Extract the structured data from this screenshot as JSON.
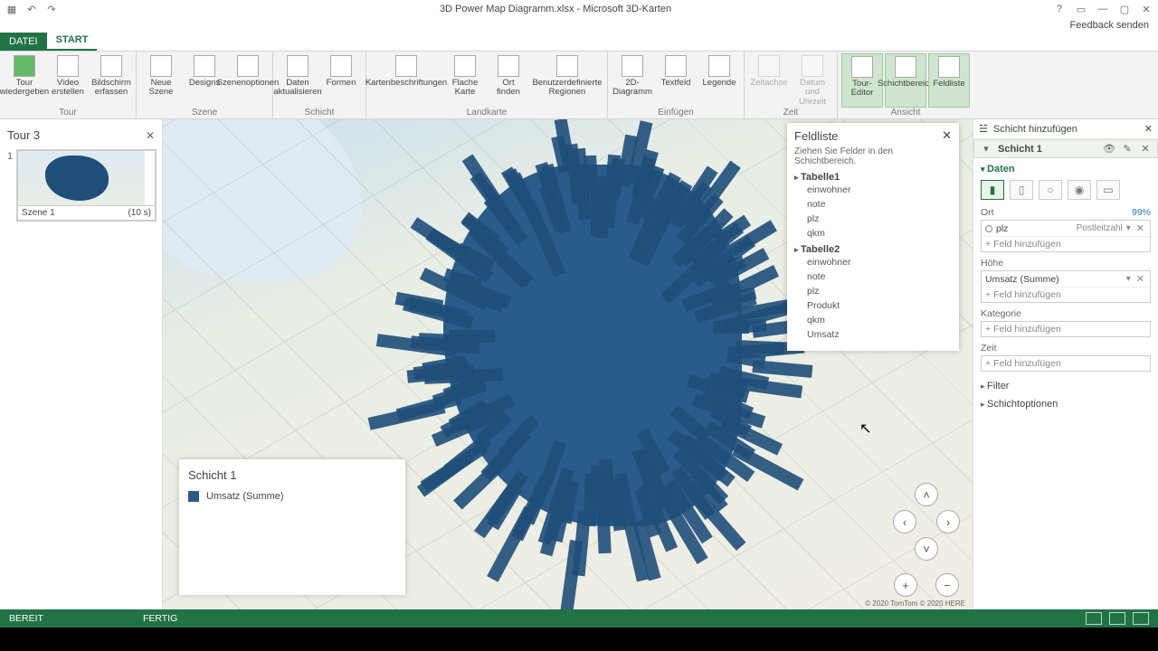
{
  "titlebar": {
    "title": "3D Power Map Diagramm.xlsx - Microsoft 3D-Karten"
  },
  "feedback": "Feedback senden",
  "tabs": {
    "file": "DATEI",
    "start": "START"
  },
  "ribbon": {
    "groups": {
      "tour": {
        "label": "Tour",
        "items": [
          "Tour\nwiedergeben",
          "Video\nerstellen",
          "Bildschirm\nerfassen"
        ]
      },
      "szene": {
        "label": "Szene",
        "items": [
          "Neue\nSzene",
          "Designs",
          "Szenenoptionen"
        ]
      },
      "schicht": {
        "label": "Schicht",
        "items": [
          "Daten\naktualisieren",
          "Formen"
        ]
      },
      "landkarte": {
        "label": "Landkarte",
        "items": [
          "Kartenbeschriftungen",
          "Flache\nKarte",
          "Ort\nfinden",
          "Benutzerdefinierte\nRegionen"
        ]
      },
      "einfuegen": {
        "label": "Einfügen",
        "items": [
          "2D-Diagramm",
          "Textfeld",
          "Legende"
        ]
      },
      "zeit": {
        "label": "Zeit",
        "items": [
          "Zeitachse",
          "Datum und\nUhrzeit"
        ]
      },
      "ansicht": {
        "label": "Ansicht",
        "items": [
          "Tour-Editor",
          "Schichtbereich",
          "Feldliste"
        ]
      }
    }
  },
  "tour": {
    "name": "Tour 3",
    "scene_num": "1",
    "scene_label": "Szene 1",
    "scene_dur": "(10 s)"
  },
  "legend": {
    "title": "Schicht 1",
    "item": "Umsatz (Summe)"
  },
  "attribution": "© 2020 TomTom © 2020 HERE",
  "fieldlist": {
    "title": "Feldliste",
    "desc": "Ziehen Sie Felder in den Schichtbereich.",
    "tables": [
      {
        "name": "Tabelle1",
        "fields": [
          "einwohner",
          "note",
          "plz",
          "qkm"
        ]
      },
      {
        "name": "Tabelle2",
        "fields": [
          "einwohner",
          "note",
          "plz",
          "Produkt",
          "qkm",
          "Umsatz"
        ]
      }
    ]
  },
  "rightpane": {
    "add_layer": "Schicht hinzufügen",
    "layer_name": "Schicht 1",
    "data_title": "Daten",
    "ort": {
      "label": "Ort",
      "pct": "99%",
      "field": "plz",
      "type": "Postleitzahl"
    },
    "add_field": "Feld hinzufügen",
    "hoehe": {
      "label": "Höhe",
      "field": "Umsatz (Summe)"
    },
    "kategorie": "Kategorie",
    "zeit": "Zeit",
    "filter": "Filter",
    "schichtopts": "Schichtoptionen"
  },
  "status": {
    "left": "BEREIT",
    "mid": "FERTIG"
  }
}
